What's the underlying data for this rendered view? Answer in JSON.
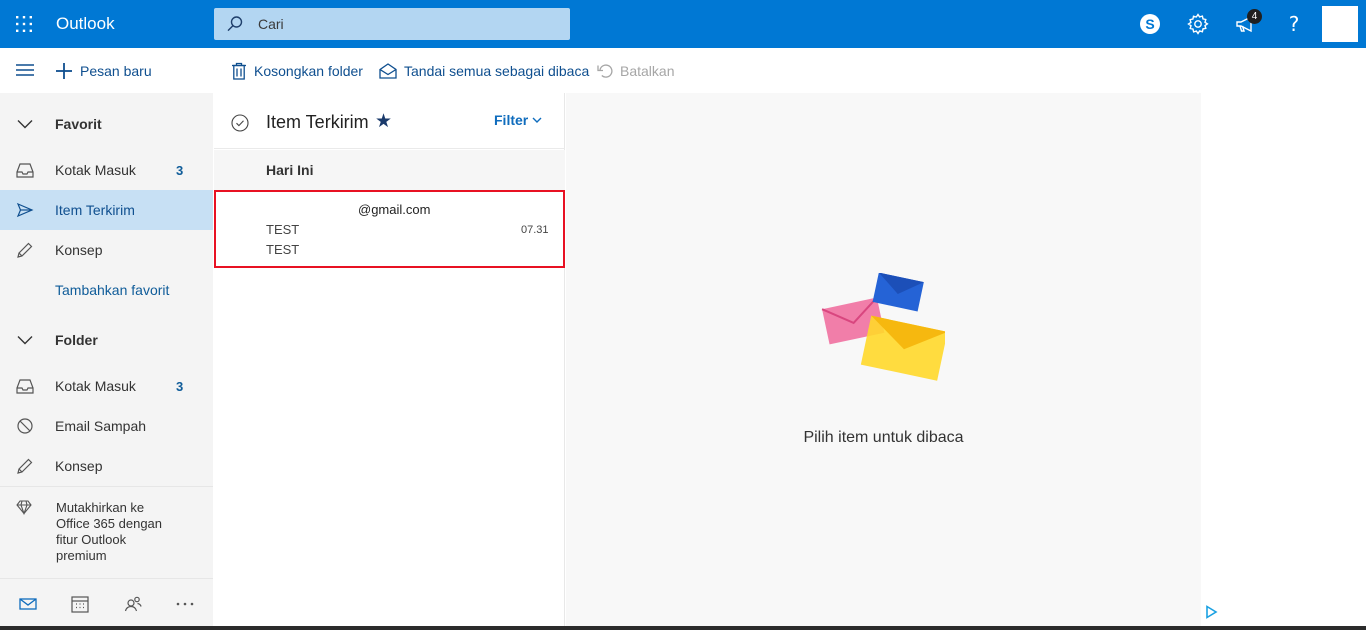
{
  "app": {
    "title": "Outlook"
  },
  "search": {
    "placeholder": "Cari"
  },
  "header": {
    "notification_count": "4"
  },
  "toolbar": {
    "new_message": "Pesan baru",
    "empty_folder": "Kosongkan folder",
    "mark_all_read": "Tandai semua sebagai dibaca",
    "undo": "Batalkan"
  },
  "sidebar": {
    "favorites": {
      "header": "Favorit",
      "items": [
        {
          "label": "Kotak Masuk",
          "count": "3"
        },
        {
          "label": "Item Terkirim",
          "count": ""
        },
        {
          "label": "Konsep",
          "count": ""
        }
      ],
      "add_favorite": "Tambahkan favorit"
    },
    "folders": {
      "header": "Folder",
      "items": [
        {
          "label": "Kotak Masuk",
          "count": "3"
        },
        {
          "label": "Email Sampah",
          "count": ""
        },
        {
          "label": "Konsep",
          "count": ""
        }
      ]
    },
    "upgrade_text": "Mutakhirkan ke Office 365 dengan fitur Outlook premium"
  },
  "message_list": {
    "folder_title": "Item Terkirim",
    "filter_label": "Filter",
    "group_header": "Hari Ini",
    "messages": [
      {
        "from": "@gmail.com",
        "subject": "TEST",
        "preview": "TEST",
        "time": "07.31"
      }
    ]
  },
  "reading_pane": {
    "empty_text": "Pilih item untuk dibaca"
  },
  "colors": {
    "brand": "#0078d4",
    "accent_link": "#0f6cbd",
    "selection": "#c7e0f4",
    "highlight_box": "#e81123"
  }
}
